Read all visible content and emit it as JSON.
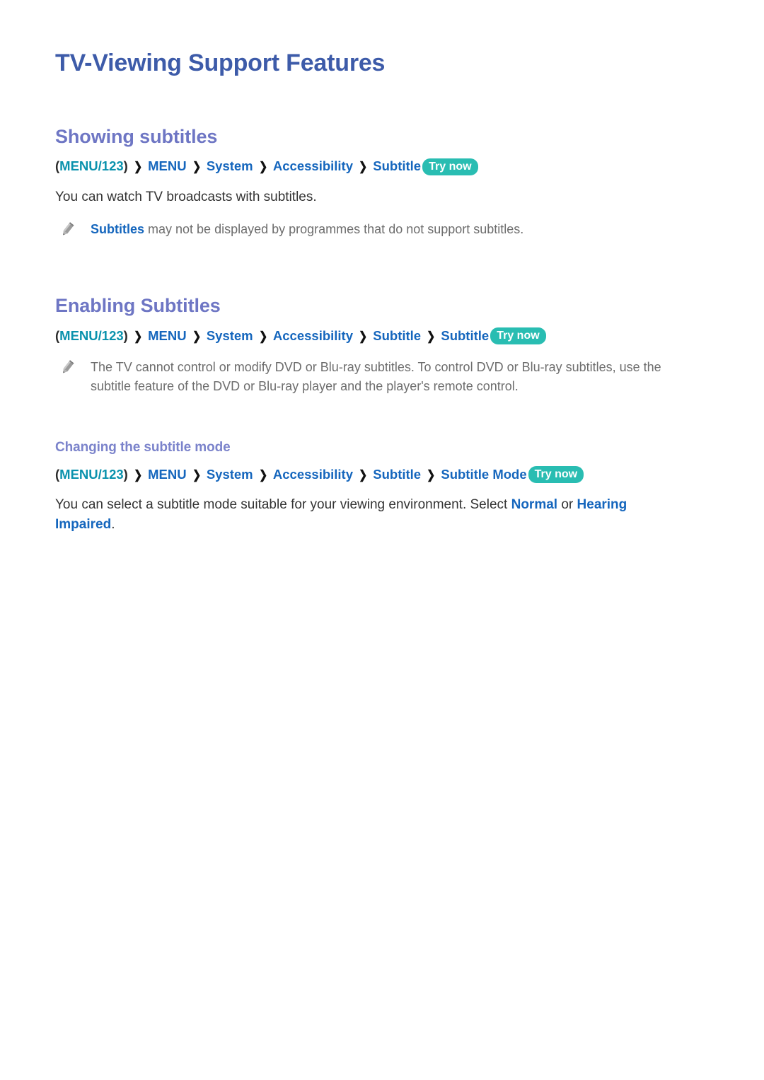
{
  "document": {
    "title": "TV-Viewing Support Features"
  },
  "sections": [
    {
      "heading": "Showing subtitles",
      "menupath": {
        "open_paren": "(",
        "key": "MENU/123",
        "close_paren": ")",
        "separator": "❯",
        "items": [
          "MENU",
          "System",
          "Accessibility",
          "Subtitle"
        ],
        "badge": "Try now"
      },
      "paragraph": "You can watch TV broadcasts with subtitles.",
      "note": {
        "icon": "pencil-icon",
        "highlight": "Subtitles",
        "rest": " may not be displayed by programmes that do not support subtitles."
      }
    },
    {
      "heading": "Enabling Subtitles",
      "menupath": {
        "open_paren": "(",
        "key": "MENU/123",
        "close_paren": ")",
        "separator": "❯",
        "items": [
          "MENU",
          "System",
          "Accessibility",
          "Subtitle",
          "Subtitle"
        ],
        "badge": "Try now"
      },
      "note": {
        "icon": "pencil-icon",
        "text": "The TV cannot control or modify DVD or Blu-ray subtitles. To control DVD or Blu-ray subtitles, use the subtitle feature of the DVD or Blu-ray player and the player's remote control."
      },
      "subsection": {
        "heading": "Changing the subtitle mode",
        "menupath": {
          "open_paren": "(",
          "key": "MENU/123",
          "close_paren": ")",
          "separator": "❯",
          "items": [
            "MENU",
            "System",
            "Accessibility",
            "Subtitle",
            "Subtitle Mode"
          ],
          "badge": "Try now"
        },
        "paragraph": {
          "part1": "You can select a subtitle mode suitable for your viewing environment. Select ",
          "hl1": "Normal",
          "part2": " or ",
          "hl2": "Hearing Impaired",
          "part3": "."
        }
      }
    }
  ],
  "colors": {
    "page_title": "#3d5ba9",
    "section_heading": "#6e76c4",
    "sub_heading": "#7b83cb",
    "menu_key": "#0a92ad",
    "menu_item": "#1566bd",
    "badge_bg": "#29bdb2",
    "badge_text": "#ffffff",
    "body_text": "#333333",
    "note_text": "#6d6d6d",
    "background": "#ffffff"
  }
}
